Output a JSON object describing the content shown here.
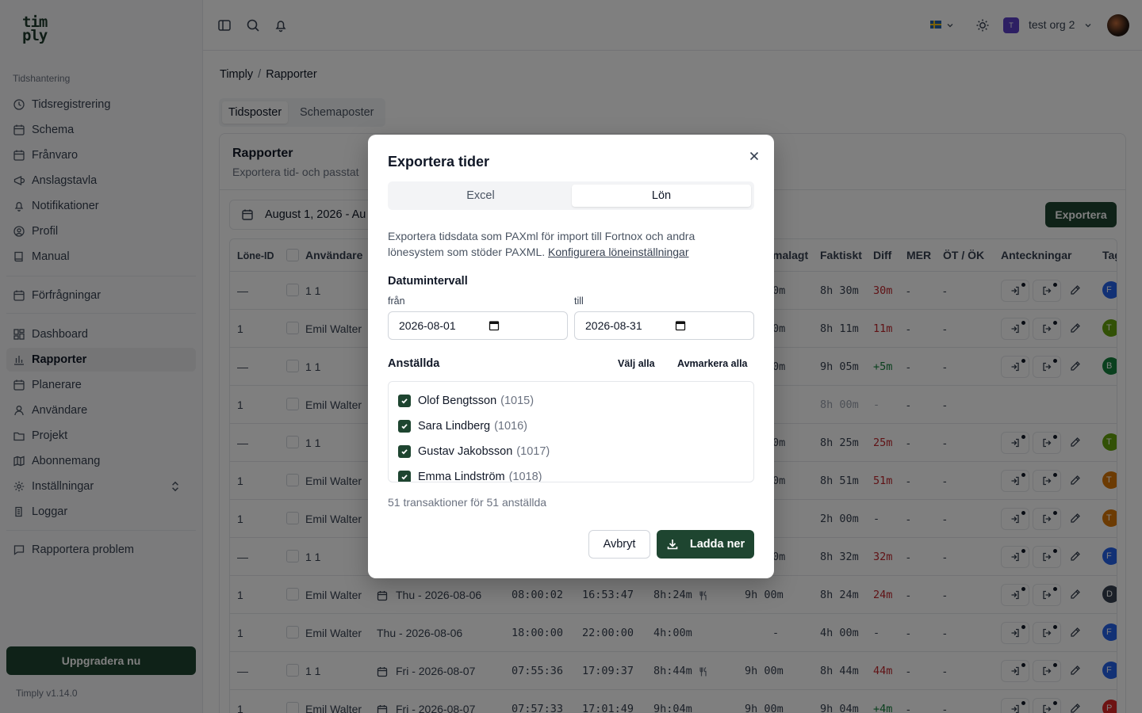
{
  "logo": {
    "line1": "tim",
    "line2": "ply"
  },
  "sidebar": {
    "section": "Tidshantering",
    "group1": [
      "Tidsregistrering",
      "Schema",
      "Frånvaro",
      "Anslagstavla",
      "Notifikationer",
      "Profil",
      "Manual"
    ],
    "group2": [
      "Förfrågningar"
    ],
    "group3": [
      "Dashboard",
      "Rapporter",
      "Planerare",
      "Användare",
      "Projekt",
      "Abonnemang",
      "Inställningar",
      "Loggar"
    ],
    "group4": [
      "Rapportera problem"
    ],
    "active": "Rapporter",
    "upgrade": "Uppgradera nu",
    "version": "Timply v1.14.0"
  },
  "topbar": {
    "org_initial": "T",
    "org_name": "test org 2"
  },
  "breadcrumb": {
    "root": "Timply",
    "sep": "/",
    "current": "Rapporter"
  },
  "tabs": [
    "Tidsposter",
    "Schemaposter"
  ],
  "card": {
    "title": "Rapporter",
    "subtitle": "Exportera tid- och passtat",
    "date_range": "August 1, 2026 - Au",
    "export_label": "Exportera"
  },
  "table": {
    "headers": {
      "lone_id": "Löne-ID",
      "user": "Användare",
      "planned": "malagt",
      "actual": "Faktiskt",
      "diff": "Diff",
      "mer": "MER",
      "ot": "ÖT / ÖK",
      "notes": "Anteckningar",
      "tag": "Tag"
    },
    "rows": [
      {
        "id": "—",
        "user": "1 1",
        "date": "",
        "in": "",
        "out": "",
        "dur": "",
        "planned": "0m",
        "actual": "8h 30m",
        "diff": "30m",
        "diff_color": "red",
        "mer": "-",
        "ot": "-",
        "actions": true,
        "tag": "F",
        "tag_color": "#2563eb"
      },
      {
        "id": "1",
        "user": "Emil Walter",
        "date": "",
        "in": "",
        "out": "",
        "dur": "",
        "planned": "0m",
        "actual": "8h 11m",
        "diff": "11m",
        "diff_color": "red",
        "mer": "-",
        "ot": "-",
        "actions": true,
        "tag": "T",
        "tag_color": "#65a30d"
      },
      {
        "id": "—",
        "user": "1 1",
        "date": "",
        "in": "",
        "out": "",
        "dur": "",
        "planned": "0m",
        "actual": "9h 05m",
        "diff": "+5m",
        "diff_color": "green",
        "mer": "-",
        "ot": "-",
        "actions": true,
        "tag": "B",
        "tag_color": "#15803d"
      },
      {
        "id": "1",
        "user": "Emil Walter",
        "date": "",
        "in": "",
        "out": "",
        "dur": "",
        "planned": "",
        "actual": "8h 00m",
        "diff": "-",
        "diff_color": "muted",
        "mer": "-",
        "ot": "-",
        "actions": false,
        "tag": "",
        "tag_color": "",
        "actual_muted": true
      },
      {
        "id": "—",
        "user": "1 1",
        "date": "",
        "in": "",
        "out": "",
        "dur": "",
        "planned": "0m",
        "actual": "8h 25m",
        "diff": "25m",
        "diff_color": "red",
        "mer": "-",
        "ot": "-",
        "actions": true,
        "tag": "T",
        "tag_color": "#65a30d"
      },
      {
        "id": "1",
        "user": "Emil Walter",
        "date": "",
        "in": "",
        "out": "",
        "dur": "",
        "planned": "0m",
        "actual": "8h 51m",
        "diff": "51m",
        "diff_color": "red",
        "mer": "-",
        "ot": "-",
        "actions": true,
        "tag": "T",
        "tag_color": "#d97706"
      },
      {
        "id": "1",
        "user": "Emil Walter",
        "date": "",
        "in": "",
        "out": "",
        "dur": "",
        "planned": "",
        "actual": "2h 00m",
        "diff": "-",
        "diff_color": "",
        "mer": "-",
        "ot": "-",
        "actions": true,
        "tag": "T",
        "tag_color": "#d97706"
      },
      {
        "id": "—",
        "user": "1 1",
        "date": "",
        "in": "",
        "out": "",
        "dur": "",
        "planned": "0m",
        "actual": "8h 32m",
        "diff": "32m",
        "diff_color": "red",
        "mer": "-",
        "ot": "-",
        "actions": true,
        "tag": "F",
        "tag_color": "#2563eb"
      },
      {
        "id": "1",
        "user": "Emil Walter",
        "date": "Thu - 2026-08-06",
        "cal": true,
        "in": "08:00:02",
        "out": "16:53:47",
        "dur": "8h:24m",
        "meal": true,
        "planned": "9h 00m",
        "actual": "8h 24m",
        "diff": "24m",
        "diff_color": "red",
        "mer": "-",
        "ot": "-",
        "actions": true,
        "tag": "D",
        "tag_color": "#374151"
      },
      {
        "id": "1",
        "user": "Emil Walter",
        "date": "Thu - 2026-08-06",
        "cal": false,
        "in": "18:00:00",
        "out": "22:00:00",
        "dur": "4h:00m",
        "meal": false,
        "planned": "-",
        "actual": "4h 00m",
        "diff": "-",
        "diff_color": "",
        "mer": "-",
        "ot": "-",
        "actions": true,
        "tag": "F",
        "tag_color": "#2563eb"
      },
      {
        "id": "—",
        "user": "1 1",
        "date": "Fri - 2026-08-07",
        "cal": true,
        "in": "07:55:36",
        "out": "17:09:37",
        "dur": "8h:44m",
        "meal": true,
        "planned": "9h 00m",
        "actual": "8h 44m",
        "diff": "44m",
        "diff_color": "red",
        "mer": "-",
        "ot": "-",
        "actions": true,
        "tag": "F",
        "tag_color": "#2563eb"
      },
      {
        "id": "1",
        "user": "Emil Walter",
        "date": "Fri - 2026-08-07",
        "cal": true,
        "in": "07:57:33",
        "out": "17:01:49",
        "dur": "9h:04m",
        "meal": false,
        "planned": "9h 00m",
        "actual": "9h 04m",
        "diff": "+4m",
        "diff_color": "green",
        "mer": "-",
        "ot": "-",
        "actions": true,
        "tag": "P",
        "tag_color": "#dc2626"
      }
    ]
  },
  "modal": {
    "title": "Exportera tider",
    "tabs": [
      "Excel",
      "Lön"
    ],
    "active_tab": "Lön",
    "description": "Exportera tidsdata som PAXml för import till Fortnox och andra lönesystem som stöder PAXML.",
    "config_link": "Konfigurera löneinställningar",
    "date_interval_label": "Datumintervall",
    "from_label": "från",
    "to_label": "till",
    "from_value": "2026-08-01",
    "to_value": "2026-08-31",
    "employees_label": "Anställda",
    "select_all": "Välj alla",
    "deselect_all": "Avmarkera alla",
    "employees": [
      {
        "name": "Olof Bengtsson",
        "id": "(1015)",
        "checked": true
      },
      {
        "name": "Sara Lindberg",
        "id": "(1016)",
        "checked": true
      },
      {
        "name": "Gustav Jakobsson",
        "id": "(1017)",
        "checked": true
      },
      {
        "name": "Emma Lindström",
        "id": "(1018)",
        "checked": true
      }
    ],
    "summary": "51 transaktioner för 51 anställda",
    "cancel": "Avbryt",
    "download": "Ladda ner"
  }
}
